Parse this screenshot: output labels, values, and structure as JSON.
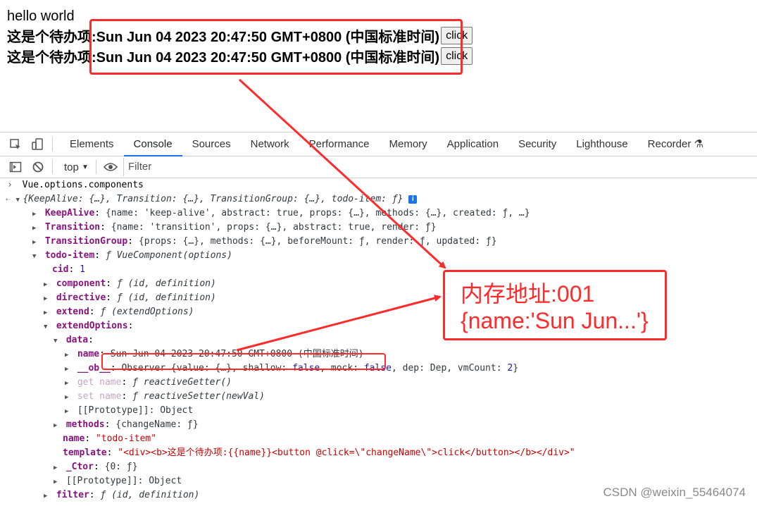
{
  "page": {
    "hello": "hello world",
    "todo_prefix": "这是个待办项:",
    "todo_date": "Sun Jun 04 2023 20:47:50 GMT+0800 (中国标准时间)",
    "button_label": "click"
  },
  "devtools": {
    "tabs": [
      "Elements",
      "Console",
      "Sources",
      "Network",
      "Performance",
      "Memory",
      "Application",
      "Security",
      "Lighthouse",
      "Recorder"
    ],
    "active_tab": "Console",
    "context": "top",
    "filter_placeholder": "Filter"
  },
  "console": {
    "input": "Vue.options.components",
    "summary": "{KeepAlive: {…}, Transition: {…}, TransitionGroup: {…}, todo-item: ƒ}",
    "keepalive_key": "KeepAlive",
    "keepalive_val": "{name: 'keep-alive', abstract: true, props: {…}, methods: {…}, created: ƒ, …}",
    "transition_key": "Transition",
    "transition_val": "{name: 'transition', props: {…}, abstract: true, render: ƒ}",
    "transitiongroup_key": "TransitionGroup",
    "transitiongroup_val": "{props: {…}, methods: {…}, beforeMount: ƒ, render: ƒ, updated: ƒ}",
    "todo_key": "todo-item",
    "todo_val": "ƒ VueComponent(options)",
    "cid_key": "cid",
    "cid_val": "1",
    "component_key": "component",
    "component_val": "ƒ (id, definition)",
    "directive_key": "directive",
    "directive_val": "ƒ (id, definition)",
    "extend_key": "extend",
    "extend_val": "ƒ (extendOptions)",
    "extendoptions_key": "extendOptions",
    "data_key": "data",
    "name_key": "name",
    "name_val": "Sun Jun 04 2023 20:47:50 GMT+0800 (中国标准时间)",
    "ob_key": "__ob__",
    "ob_val": "Observer {value: {…}, shallow: false, mock: false, dep: Dep, vmCount: 2}",
    "get_key": "get name",
    "get_val": "ƒ reactiveGetter()",
    "set_key": "set name",
    "set_val": "ƒ reactiveSetter(newVal)",
    "proto1": "[[Prototype]]: Object",
    "methods_key": "methods",
    "methods_val": "{changeName: ƒ}",
    "name2_key": "name",
    "name2_val": "\"todo-item\"",
    "template_key": "template",
    "template_val": "\"<div><b>这是个待办项:{{name}}<button @click=\\\"changeName\\\">click</button></b></div>\"",
    "ctor_key": "_Ctor",
    "ctor_val": "{0: ƒ}",
    "proto2": "[[Prototype]]: Object",
    "filter_key": "filter",
    "filter_val": "ƒ (id, definition)"
  },
  "annotation": {
    "line1": "内存地址:001",
    "line2": "{name:'Sun Jun...'}"
  },
  "watermark": "CSDN @weixin_55464074",
  "colors": {
    "annotation": "#ff2a2a",
    "accent": "#1a73e8"
  }
}
